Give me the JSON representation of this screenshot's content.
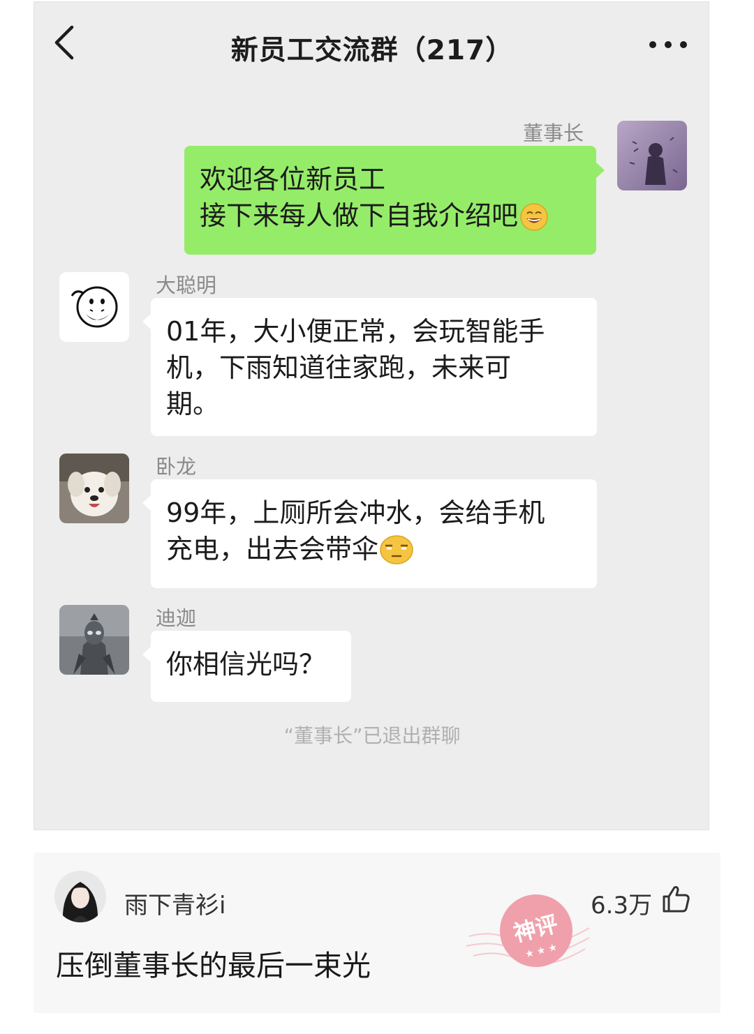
{
  "chat": {
    "title": "新员工交流群（217）",
    "messages": [
      {
        "sender": "董事长",
        "lines": [
          "欢迎各位新员工",
          "接下来每人做下自我介绍吧"
        ],
        "emoji": "grin-emoji",
        "direction": "outgoing"
      },
      {
        "sender": "大聪明",
        "lines": [
          "01年，大小便正常，会玩智能手",
          "机，下雨知道往家跑，未来可",
          "期。"
        ],
        "direction": "incoming"
      },
      {
        "sender": "卧龙",
        "lines": [
          "99年，上厕所会冲水，会给手机",
          "充电，出去会带伞"
        ],
        "emoji": "smirk-emoji",
        "direction": "incoming"
      },
      {
        "sender": "迪迦",
        "lines": [
          "你相信光吗？"
        ],
        "direction": "incoming"
      }
    ],
    "system_notice": "“董事长”已退出群聊"
  },
  "comment": {
    "username": "雨下青衫i",
    "likes": "6.3万",
    "text": "压倒董事长的最后一束光",
    "badge": "神评"
  },
  "colors": {
    "chat_bg": "#ededed",
    "outgoing_bubble": "#95ec69",
    "incoming_bubble": "#ffffff",
    "badge_red": "#f0a0ab"
  },
  "icons": [
    "back-arrow-icon",
    "more-dots-icon",
    "thumbs-up-icon"
  ]
}
